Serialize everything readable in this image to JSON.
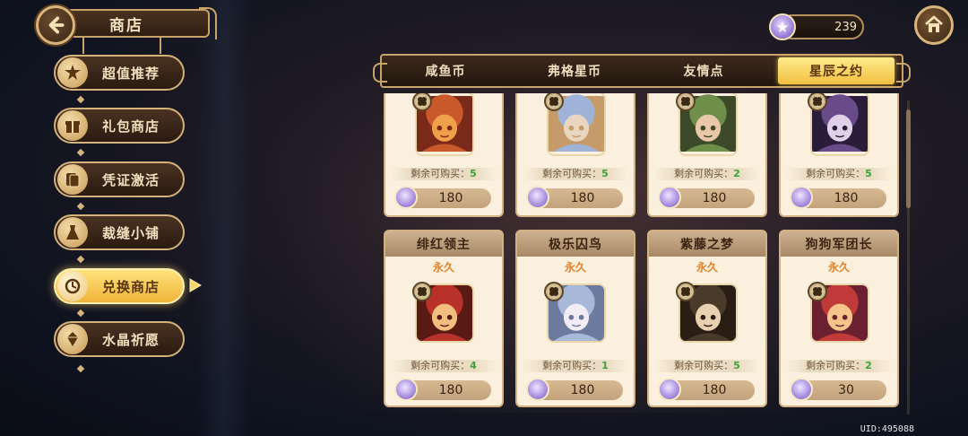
{
  "header": {
    "title": "商店"
  },
  "currency": {
    "amount": "239"
  },
  "nav": [
    {
      "label": "超值推荐",
      "icon": "star-burst-icon",
      "active": false
    },
    {
      "label": "礼包商店",
      "icon": "gift-box-icon",
      "active": false
    },
    {
      "label": "凭证激活",
      "icon": "card-icon",
      "active": false
    },
    {
      "label": "裁缝小铺",
      "icon": "dress-icon",
      "active": false
    },
    {
      "label": "兑换商店",
      "icon": "exchange-icon",
      "active": true
    },
    {
      "label": "水晶祈愿",
      "icon": "crystal-icon",
      "active": false
    }
  ],
  "tabs": [
    {
      "label": "咸鱼币",
      "active": false
    },
    {
      "label": "弗格星币",
      "active": false
    },
    {
      "label": "友情点",
      "active": false
    },
    {
      "label": "星辰之约",
      "active": true
    }
  ],
  "remain_label": "剩余可购买：",
  "top_row": [
    {
      "remaining": "5",
      "price": "180",
      "palette": [
        "#c9582a",
        "#f0a04a",
        "#7a2a18"
      ]
    },
    {
      "remaining": "5",
      "price": "180",
      "palette": [
        "#9fb3d8",
        "#e8d6c0",
        "#c59b6a"
      ]
    },
    {
      "remaining": "2",
      "price": "180",
      "palette": [
        "#6e8f4a",
        "#e8c8a8",
        "#3d4a2a"
      ]
    },
    {
      "remaining": "5",
      "price": "180",
      "palette": [
        "#6a4b8a",
        "#e0d0e8",
        "#2a1d3a"
      ]
    }
  ],
  "bottom_row": [
    {
      "name": "绯红领主",
      "duration": "永久",
      "remaining": "4",
      "price": "180",
      "palette": [
        "#b8322a",
        "#f1c080",
        "#5a1a14"
      ]
    },
    {
      "name": "极乐囚鸟",
      "duration": "永久",
      "remaining": "1",
      "price": "180",
      "palette": [
        "#a8b8d8",
        "#f2ecf4",
        "#6c7aa0"
      ]
    },
    {
      "name": "紫藤之梦",
      "duration": "永久",
      "remaining": "5",
      "price": "180",
      "palette": [
        "#4a3a2a",
        "#e8d0b0",
        "#2a1e14"
      ]
    },
    {
      "name": "狗狗军团长",
      "duration": "永久",
      "remaining": "2",
      "price": "30",
      "palette": [
        "#c03a3a",
        "#f4c48a",
        "#6a2030"
      ]
    }
  ],
  "uid": "UID:495088"
}
